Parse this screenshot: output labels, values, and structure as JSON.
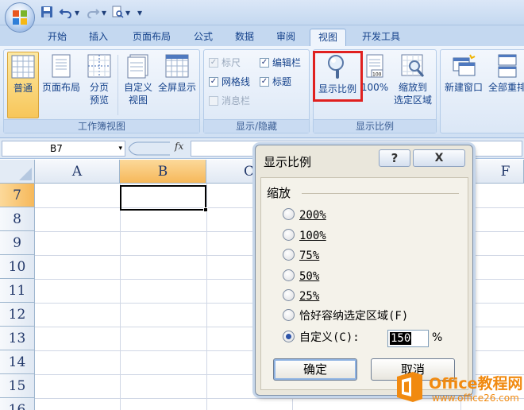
{
  "colors": {
    "accent_red": "#e0201f",
    "ribbon_blue": "#15428b",
    "watermark_orange": "#f18a10"
  },
  "quick_access": {
    "icons": [
      "save-icon",
      "undo-icon",
      "redo-icon",
      "print-preview-icon",
      "customize-icon"
    ],
    "dropdown_glyph": "▾"
  },
  "tabs": [
    {
      "label": "开始"
    },
    {
      "label": "插入"
    },
    {
      "label": "页面布局"
    },
    {
      "label": "公式"
    },
    {
      "label": "数据"
    },
    {
      "label": "审阅"
    },
    {
      "label": "视图"
    },
    {
      "label": "开发工具"
    }
  ],
  "active_tab": "视图",
  "ribbon": {
    "workbook_views": {
      "label": "工作簿视图",
      "buttons": {
        "normal": "普通",
        "page_layout": "页面布局",
        "page_break_1": "分页",
        "page_break_2": "预览",
        "custom_1": "自定义",
        "custom_2": "视图",
        "full_screen": "全屏显示"
      }
    },
    "show_hide": {
      "label": "显示/隐藏",
      "ruler": "标尺",
      "formula_bar": "编辑栏",
      "gridlines": "网格线",
      "headings": "标题",
      "message_bar": "消息栏",
      "check_glyph": "✓"
    },
    "zoom": {
      "label": "显示比例",
      "zoom_button": "显示比例",
      "zoom100": "100%",
      "zoom100_icon_text": "100",
      "zoom_selection_1": "缩放到",
      "zoom_selection_2": "选定区域"
    },
    "window": {
      "new_window": "新建窗口",
      "arrange_all": "全部重排"
    }
  },
  "formula_bar": {
    "name_box": "B7",
    "fx": "fx",
    "dropdown_glyph": "▾"
  },
  "grid": {
    "columns": [
      "A",
      "B",
      "C",
      "F"
    ],
    "rows": [
      "7",
      "8",
      "9",
      "10",
      "11",
      "12",
      "13",
      "14",
      "15",
      "16"
    ],
    "selected_column": "B",
    "selected_row": "7"
  },
  "dialog": {
    "title": "显示比例",
    "help": "?",
    "close": "X",
    "group_caption": "缩放",
    "options": [
      "200%",
      "100%",
      "75%",
      "50%",
      "25%",
      "恰好容纳选定区域(F)",
      "自定义(C):"
    ],
    "selected_option": 6,
    "custom_value": "150",
    "percent_sign": "%",
    "ok": "确定",
    "cancel": "取消"
  },
  "watermark": {
    "text": "Office教程网",
    "url": "www.office26.com"
  }
}
